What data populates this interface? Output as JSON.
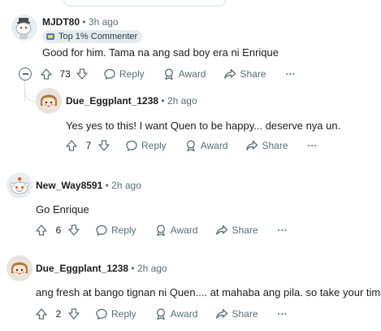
{
  "comments": [
    {
      "username": "MJDT80",
      "separator": "•",
      "time": "3h ago",
      "flair": "Top 1% Commenter",
      "body": "Good for him. Tama na ang sad boy era ni Enrique",
      "votes": "73",
      "reply_label": "Reply",
      "award_label": "Award",
      "share_label": "Share",
      "more_label": "···"
    },
    {
      "username": "Due_Eggplant_1238",
      "separator": "•",
      "time": "2h ago",
      "body": "Yes yes to this! I want Quen to be happy... deserve nya un.",
      "votes": "7",
      "reply_label": "Reply",
      "award_label": "Award",
      "share_label": "Share",
      "more_label": "···"
    },
    {
      "username": "New_Way8591",
      "separator": "•",
      "time": "2h ago",
      "body": "Go Enrique",
      "votes": "6",
      "reply_label": "Reply",
      "award_label": "Award",
      "share_label": "Share",
      "more_label": "···"
    },
    {
      "username": "Due_Eggplant_1238",
      "separator": "•",
      "time": "2h ago",
      "body": "ang fresh at bango tignan ni Quen.... at mahaba ang pila. so take your time.",
      "votes": "2",
      "reply_label": "Reply",
      "award_label": "Award",
      "share_label": "Share",
      "more_label": "···"
    }
  ]
}
